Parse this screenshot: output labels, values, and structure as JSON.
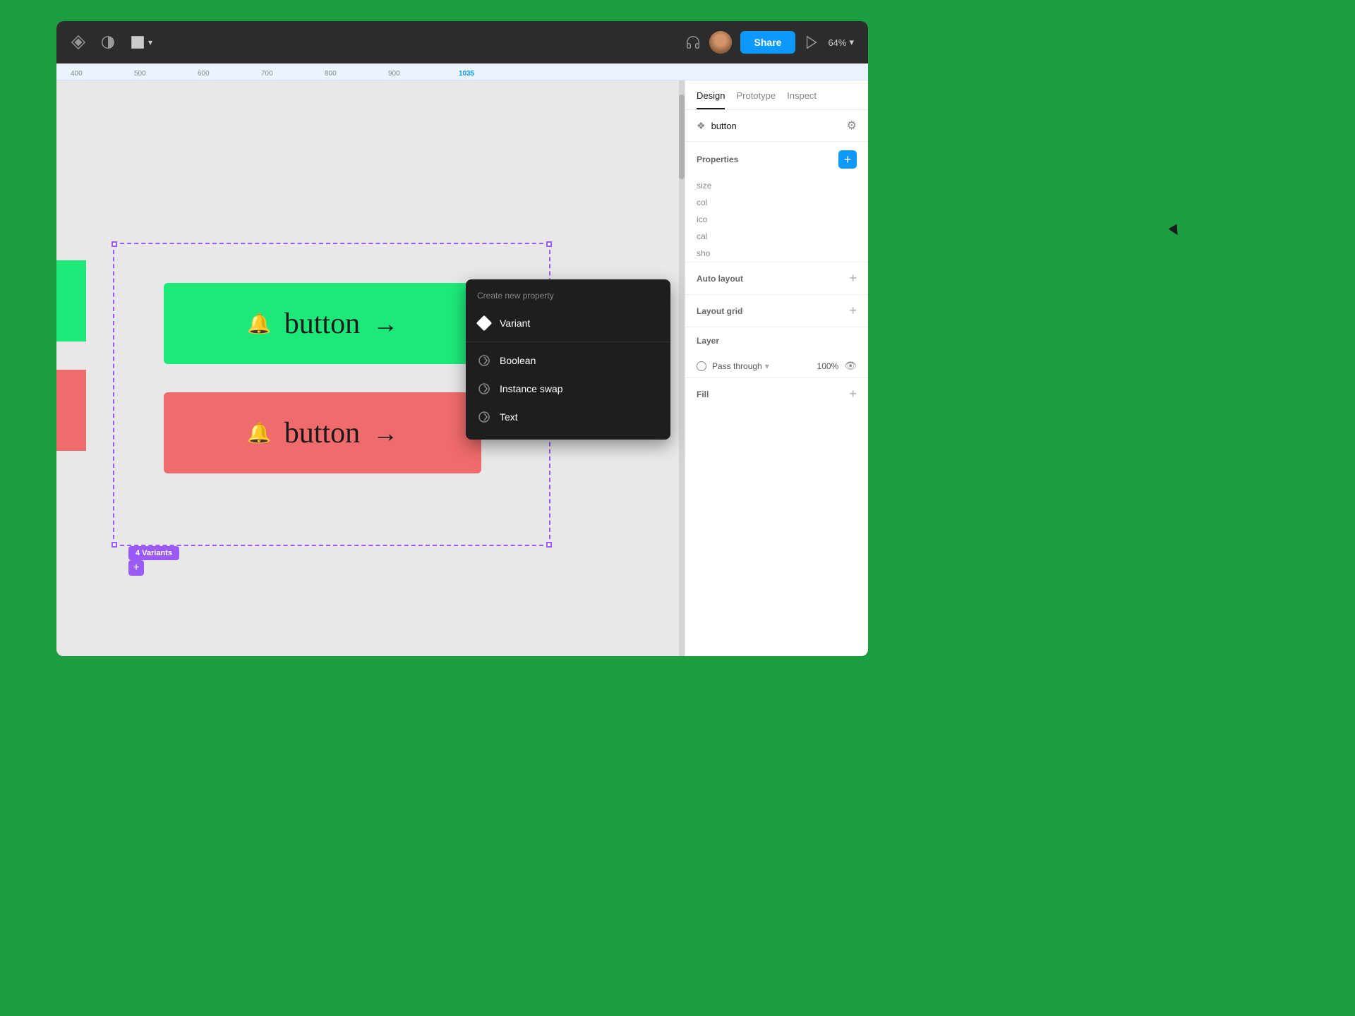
{
  "app": {
    "title": "Figma"
  },
  "toolbar": {
    "share_label": "Share",
    "zoom_label": "64%",
    "tabs": [
      "Design",
      "Prototype",
      "Inspect"
    ]
  },
  "component": {
    "name": "button",
    "icon": "❖"
  },
  "properties_section": {
    "title": "Properties",
    "add_button": "+",
    "rows": [
      {
        "key": "size"
      },
      {
        "key": "col"
      },
      {
        "key": "ico"
      },
      {
        "key": "cal"
      },
      {
        "key": "sho"
      }
    ]
  },
  "dropdown": {
    "header": "Create new property",
    "items": [
      {
        "label": "Variant",
        "icon": "diamond"
      },
      {
        "label": "Boolean",
        "icon": "circle-arrow"
      },
      {
        "label": "Instance swap",
        "icon": "circle-arrow"
      },
      {
        "label": "Text",
        "icon": "circle-arrow"
      }
    ]
  },
  "canvas": {
    "buttons": [
      {
        "text": "button",
        "color": "green"
      },
      {
        "text": "button",
        "color": "red"
      }
    ],
    "variants_badge": "4 Variants"
  },
  "ruler": {
    "marks": [
      "400",
      "500",
      "600",
      "700",
      "800",
      "900",
      "1035"
    ]
  },
  "auto_layout": {
    "title": "Auto layout",
    "add_icon": "+"
  },
  "layout_grid": {
    "title": "Layout grid",
    "add_icon": "+"
  },
  "layer": {
    "title": "Layer",
    "blend_mode": "Pass through",
    "opacity": "100%"
  },
  "fill": {
    "title": "Fill",
    "add_icon": "+"
  }
}
